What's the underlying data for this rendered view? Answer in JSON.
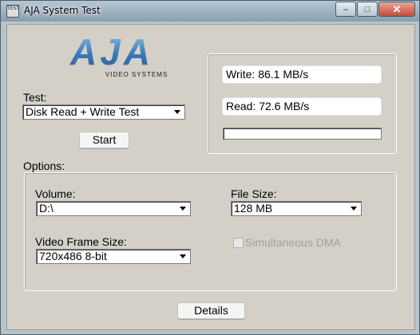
{
  "window": {
    "title": "AJA System Test",
    "icon_text": "TEST",
    "controls": {
      "minimize": "–",
      "maximize": "□",
      "close": "✕"
    }
  },
  "logo": {
    "wordmark": "AJA",
    "tagline": "VIDEO SYSTEMS",
    "colors": {
      "primary": "#3b7ab6",
      "highlight": "#8fc0ea"
    }
  },
  "test": {
    "label": "Test:",
    "selected": "Disk Read + Write Test",
    "start_label": "Start"
  },
  "results": {
    "write": "Write: 86.1 MB/s",
    "read": "Read: 72.6 MB/s",
    "progress": 0
  },
  "options": {
    "label": "Options:",
    "volume": {
      "label": "Volume:",
      "selected": "D:\\"
    },
    "file_size": {
      "label": "File Size:",
      "selected": "128 MB"
    },
    "frame_size": {
      "label": "Video Frame Size:",
      "selected": "720x486 8-bit"
    },
    "simultaneous_dma": {
      "label": "Simultaneous DMA",
      "checked": false,
      "enabled": false
    }
  },
  "details_label": "Details"
}
